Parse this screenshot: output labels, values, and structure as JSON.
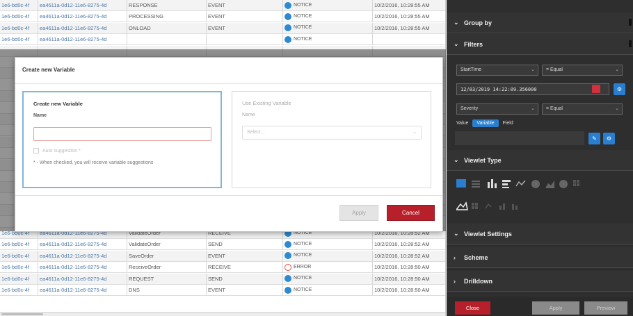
{
  "table": {
    "rows": [
      {
        "id": "1e6-bd0c-4f",
        "uuid": "ea4611a-0d12-11e6-8275-4d",
        "name": "RESPONSE",
        "type": "EVENT",
        "level": "NOTICE",
        "time": "10/2/2016, 10:28:55 AM"
      },
      {
        "id": "1e6-bd0c-4f",
        "uuid": "ea4611a-0d12-11e6-8275-4d",
        "name": "PROCESSING",
        "type": "EVENT",
        "level": "NOTICE",
        "time": "10/2/2016, 10:28:55 AM"
      },
      {
        "id": "1e6-bd0c-4f",
        "uuid": "ea4611a-0d12-11e6-8275-4d",
        "name": "ONLOAD",
        "type": "EVENT",
        "level": "NOTICE",
        "time": "10/2/2016, 10:28:55 AM"
      },
      {
        "id": "1e6-bd0c-4f",
        "uuid": "ea4611a-0d12-11e6-8275-4d",
        "name": "",
        "type": "",
        "level": "NOTICE",
        "time": ""
      },
      {
        "id": "",
        "uuid": "",
        "name": "",
        "type": "",
        "level": "",
        "time": ""
      },
      {
        "id": "",
        "uuid": "",
        "name": "",
        "type": "",
        "level": "",
        "time": ""
      },
      {
        "id": "",
        "uuid": "",
        "name": "",
        "type": "",
        "level": "",
        "time": ""
      },
      {
        "id": "",
        "uuid": "",
        "name": "",
        "type": "",
        "level": "",
        "time": ""
      },
      {
        "id": "",
        "uuid": "",
        "name": "",
        "type": "",
        "level": "",
        "time": ""
      },
      {
        "id": "",
        "uuid": "",
        "name": "",
        "type": "",
        "level": "",
        "time": ""
      },
      {
        "id": "",
        "uuid": "",
        "name": "",
        "type": "",
        "level": "",
        "time": ""
      },
      {
        "id": "",
        "uuid": "",
        "name": "",
        "type": "",
        "level": "",
        "time": ""
      },
      {
        "id": "",
        "uuid": "",
        "name": "",
        "type": "",
        "level": "",
        "time": ""
      },
      {
        "id": "",
        "uuid": "",
        "name": "",
        "type": "",
        "level": "",
        "time": ""
      },
      {
        "id": "",
        "uuid": "",
        "name": "",
        "type": "",
        "level": "",
        "time": ""
      },
      {
        "id": "",
        "uuid": "",
        "name": "",
        "type": "",
        "level": "",
        "time": ""
      },
      {
        "id": "",
        "uuid": "",
        "name": "",
        "type": "",
        "level": "",
        "time": ""
      },
      {
        "id": "",
        "uuid": "",
        "name": "",
        "type": "",
        "level": "",
        "time": ""
      },
      {
        "id": "",
        "uuid": "",
        "name": "",
        "type": "",
        "level": "",
        "time": ""
      },
      {
        "id": "",
        "uuid": "",
        "name": "",
        "type": "",
        "level": "",
        "time": ""
      },
      {
        "id": "1e6-bd0c-4f",
        "uuid": "ea4611a-0d12-11e6-8275-4d",
        "name": "ValidateOrder",
        "type": "RECEIVE",
        "level": "NOTICE",
        "time": "10/2/2016, 10:28:52 AM"
      },
      {
        "id": "1e6-bd0c-4f",
        "uuid": "ea4611a-0d12-11e6-8275-4d",
        "name": "ValidateOrder",
        "type": "SEND",
        "level": "NOTICE",
        "time": "10/2/2016, 10:28:52 AM"
      },
      {
        "id": "1e6-bd0c-4f",
        "uuid": "ea4611a-0d12-11e6-8275-4d",
        "name": "SaveOrder",
        "type": "EVENT",
        "level": "NOTICE",
        "time": "10/2/2016, 10:28:52 AM"
      },
      {
        "id": "1e6-bd0c-4f",
        "uuid": "ea4611a-0d12-11e6-8275-4d",
        "name": "ReceiveOrder",
        "type": "RECEIVE",
        "level": "ERROR",
        "time": "10/2/2016, 10:28:50 AM"
      },
      {
        "id": "1e6-bd0c-4f",
        "uuid": "ea4611a-0d12-11e6-8275-4d",
        "name": "REQUEST",
        "type": "SEND",
        "level": "NOTICE",
        "time": "10/2/2016, 10:28:50 AM"
      },
      {
        "id": "1e6-bd0c-4f",
        "uuid": "ea4611a-0d12-11e6-8275-4d",
        "name": "DNS",
        "type": "EVENT",
        "level": "NOTICE",
        "time": "10/2/2016, 10:28:50 AM"
      }
    ]
  },
  "modal": {
    "title": "Create new Variable",
    "left": {
      "title": "Create new Variable",
      "name_label": "Name",
      "name_value": "",
      "auto_label": "Auto suggestion *",
      "hint": "* - When checked, you will receive variable suggestions"
    },
    "right": {
      "title": "Use Existing Variable",
      "name_label": "Name",
      "select_placeholder": "Select..."
    },
    "apply_label": "Apply",
    "cancel_label": "Cancel"
  },
  "side": {
    "group_by": "Group by",
    "filters": "Filters",
    "filter1_field": "StartTime",
    "filter1_op": "= Equal",
    "filter1_value": "12/03/2019 14:22:09.356000",
    "filter2_field": "Severity",
    "filter2_op": "= Equal",
    "value_tabs": [
      "Value",
      "Variable",
      "Field"
    ],
    "active_tab": "Variable",
    "viewlet_type": "Viewlet Type",
    "viewlet_settings": "Viewlet Settings",
    "scheme": "Scheme",
    "drilldown": "Drilldown",
    "close_label": "Close",
    "apply_label": "Apply",
    "preview_label": "Preview"
  },
  "colors": {
    "accent": "#2a7ed0",
    "danger": "#b7202b",
    "panel_bg": "#2e2e2e"
  }
}
